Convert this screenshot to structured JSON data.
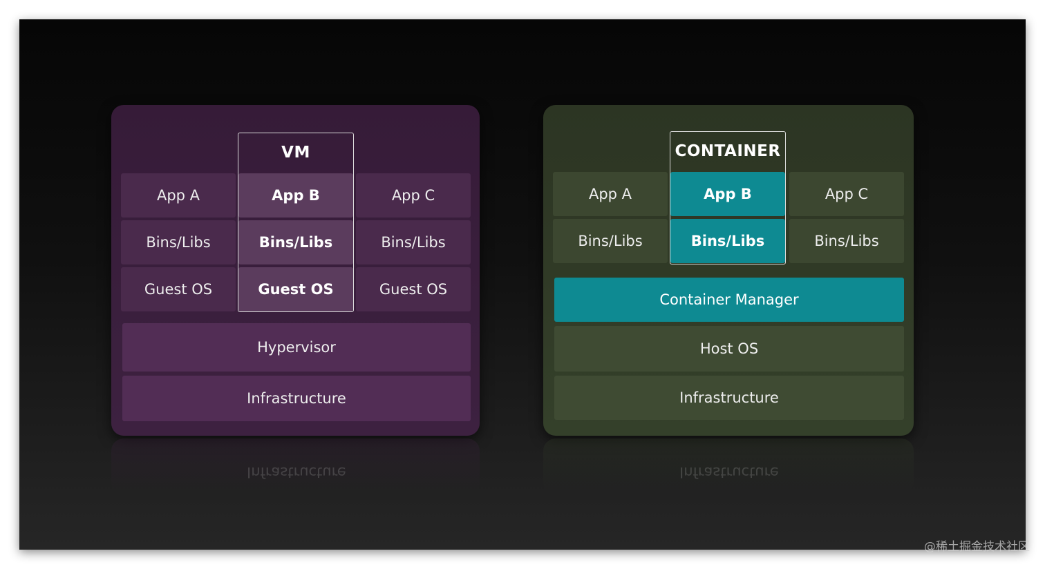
{
  "vm_diagram": {
    "frame_title": "VM",
    "rows": [
      [
        "App A",
        "App B",
        "App C"
      ],
      [
        "Bins/Libs",
        "Bins/Libs",
        "Bins/Libs"
      ],
      [
        "Guest OS",
        "Guest OS",
        "Guest OS"
      ]
    ],
    "layers": [
      "Hypervisor",
      "Infrastructure"
    ],
    "reflection": "Infrastructure"
  },
  "container_diagram": {
    "frame_title": "CONTAINER",
    "rows": [
      [
        "App A",
        "App B",
        "App C"
      ],
      [
        "Bins/Libs",
        "Bins/Libs",
        "Bins/Libs"
      ]
    ],
    "layers": [
      "Container Manager",
      "Host OS",
      "Infrastructure"
    ],
    "reflection": "Infrastructure"
  },
  "watermark": "@稀土掘金技术社区",
  "colors": {
    "vm_panel": "#3a1f3d",
    "container_panel": "#313b27",
    "accent_teal": "#0e8a92"
  }
}
